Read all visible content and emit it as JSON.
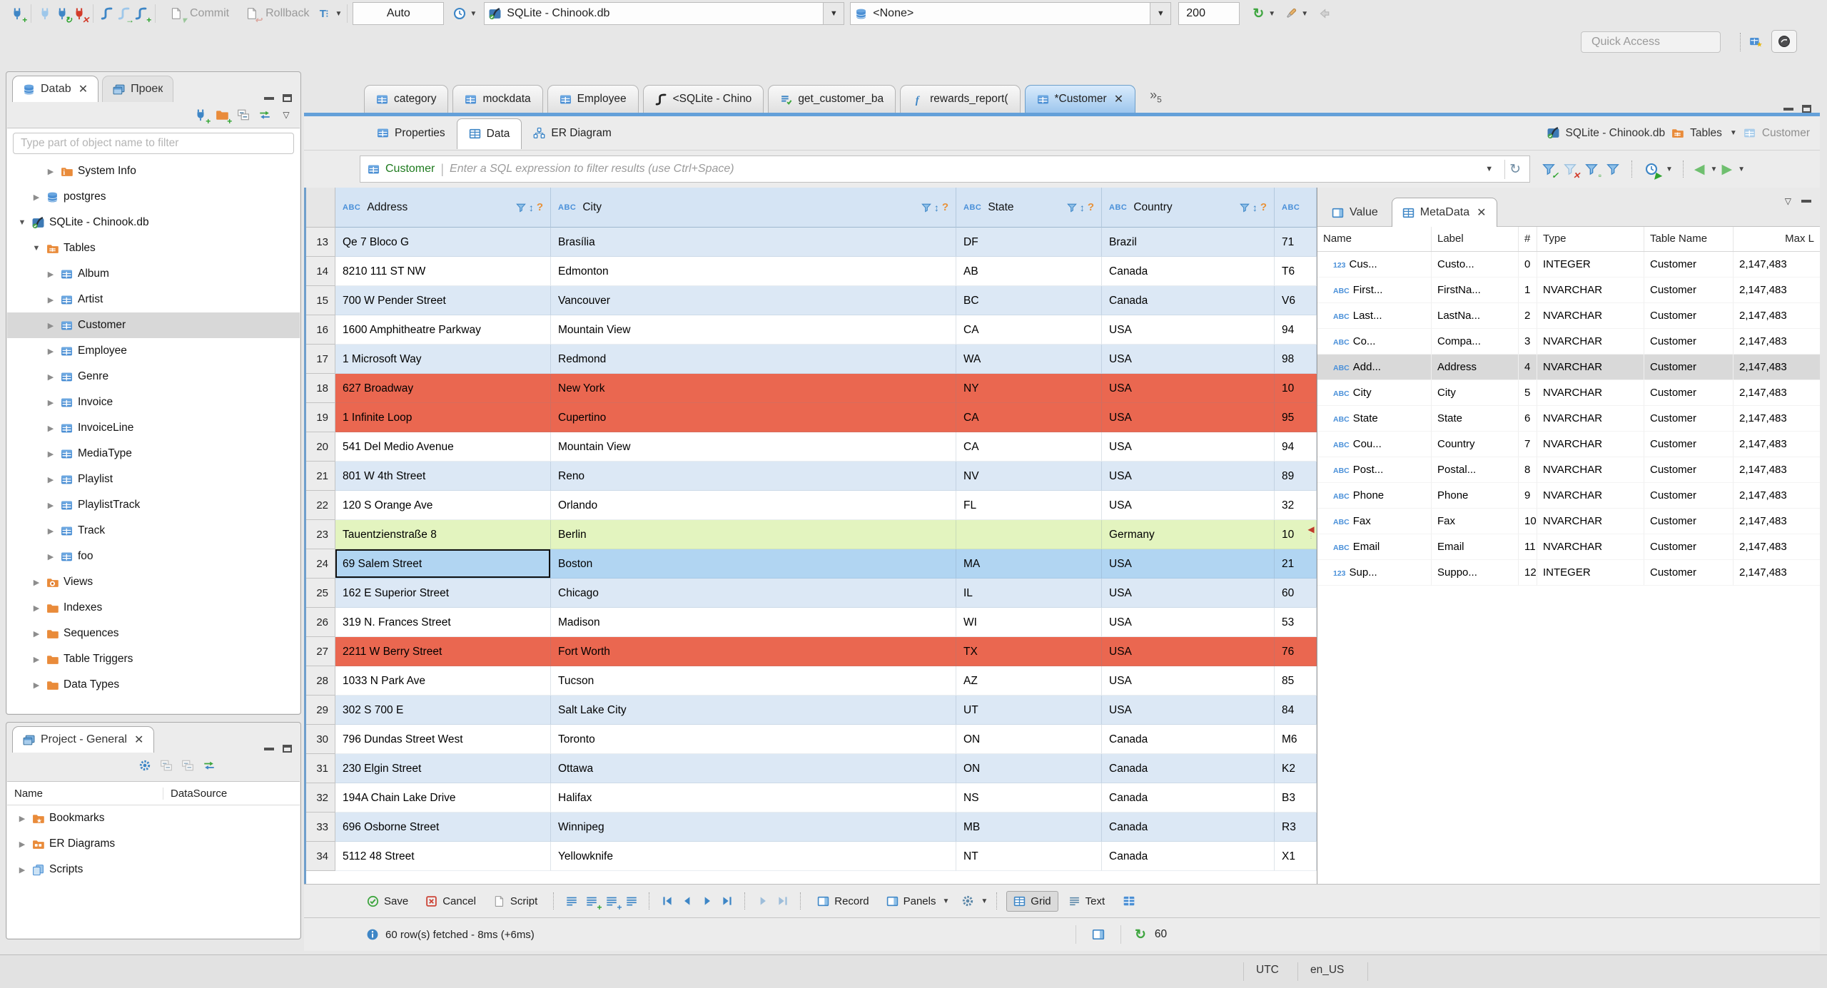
{
  "toolbar": {
    "commit_label": "Commit",
    "rollback_label": "Rollback",
    "auto_label": "Auto",
    "connection_value": "SQLite - Chinook.db",
    "database_value": "<None>",
    "fetch_size_value": "200",
    "quick_access_label": "Quick Access"
  },
  "navigator": {
    "tab_database": "Datab",
    "tab_project": "Проек",
    "filter_placeholder": "Type part of object name to filter",
    "tree": [
      {
        "label": "System Info",
        "icon": "#i-folder-info",
        "d": "d3",
        "arrow": "col",
        "sel": ""
      },
      {
        "label": "postgres",
        "icon": "#i-db",
        "d": "d2",
        "arrow": "col",
        "sel": ""
      },
      {
        "label": "SQLite - Chinook.db",
        "icon": "#i-sqlite",
        "d": "d1",
        "arrow": "exp",
        "sel": ""
      },
      {
        "label": "Tables",
        "icon": "#i-folder-tables",
        "d": "d2",
        "arrow": "exp",
        "sel": ""
      },
      {
        "label": "Album",
        "icon": "#i-table",
        "d": "d3",
        "arrow": "col",
        "sel": ""
      },
      {
        "label": "Artist",
        "icon": "#i-table",
        "d": "d3",
        "arrow": "col",
        "sel": ""
      },
      {
        "label": "Customer",
        "icon": "#i-table",
        "d": "d3",
        "arrow": "col",
        "sel": "sel"
      },
      {
        "label": "Employee",
        "icon": "#i-table",
        "d": "d3",
        "arrow": "col",
        "sel": ""
      },
      {
        "label": "Genre",
        "icon": "#i-table",
        "d": "d3",
        "arrow": "col",
        "sel": ""
      },
      {
        "label": "Invoice",
        "icon": "#i-table",
        "d": "d3",
        "arrow": "col",
        "sel": ""
      },
      {
        "label": "InvoiceLine",
        "icon": "#i-table",
        "d": "d3",
        "arrow": "col",
        "sel": ""
      },
      {
        "label": "MediaType",
        "icon": "#i-table",
        "d": "d3",
        "arrow": "col",
        "sel": ""
      },
      {
        "label": "Playlist",
        "icon": "#i-table",
        "d": "d3",
        "arrow": "col",
        "sel": ""
      },
      {
        "label": "PlaylistTrack",
        "icon": "#i-table",
        "d": "d3",
        "arrow": "col",
        "sel": ""
      },
      {
        "label": "Track",
        "icon": "#i-table",
        "d": "d3",
        "arrow": "col",
        "sel": ""
      },
      {
        "label": "foo",
        "icon": "#i-table",
        "d": "d3",
        "arrow": "col",
        "sel": ""
      },
      {
        "label": "Views",
        "icon": "#i-folder-views",
        "d": "d2",
        "arrow": "col",
        "sel": ""
      },
      {
        "label": "Indexes",
        "icon": "#i-folder",
        "d": "d2",
        "arrow": "col",
        "sel": ""
      },
      {
        "label": "Sequences",
        "icon": "#i-folder",
        "d": "d2",
        "arrow": "col",
        "sel": ""
      },
      {
        "label": "Table Triggers",
        "icon": "#i-folder",
        "d": "d2",
        "arrow": "col",
        "sel": ""
      },
      {
        "label": "Data Types",
        "icon": "#i-folder",
        "d": "d2",
        "arrow": "col",
        "sel": ""
      }
    ]
  },
  "project": {
    "title": "Project - General",
    "col_name": "Name",
    "col_datasource": "DataSource",
    "tree": [
      {
        "label": "Bookmarks",
        "icon": "#i-folder-star",
        "d": "d1",
        "arrow": "col",
        "sel": ""
      },
      {
        "label": "ER Diagrams",
        "icon": "#i-folder-er",
        "d": "d1",
        "arrow": "col",
        "sel": ""
      },
      {
        "label": "Scripts",
        "icon": "#i-scripts",
        "d": "d1",
        "arrow": "col",
        "sel": ""
      }
    ]
  },
  "editor": {
    "tabs": [
      {
        "label": "category",
        "icon": "#i-table",
        "state": "",
        "close": ""
      },
      {
        "label": "mockdata",
        "icon": "#i-table",
        "state": "",
        "close": ""
      },
      {
        "label": "Employee",
        "icon": "#i-table",
        "state": "",
        "close": ""
      },
      {
        "label": "<SQLite - Chino",
        "icon": "#i-sql",
        "state": "",
        "close": ""
      },
      {
        "label": "get_customer_ba",
        "icon": "#i-script-file",
        "state": "",
        "close": ""
      },
      {
        "label": "rewards_report(",
        "icon": "#i-fx",
        "state": "",
        "close": ""
      },
      {
        "label": "*Customer",
        "icon": "#i-table",
        "state": "active",
        "close": "show"
      }
    ],
    "overflow_count": "5",
    "subtab_properties": "Properties",
    "subtab_data": "Data",
    "subtab_er": "ER Diagram",
    "context_connection": "SQLite - Chinook.db",
    "context_container": "Tables",
    "context_object": "Customer"
  },
  "filter": {
    "table_label": "Customer",
    "placeholder": "Enter a SQL expression to filter results (use Ctrl+Space)"
  },
  "grid": {
    "columns": [
      "Address",
      "City",
      "State",
      "Country"
    ],
    "rows": [
      {
        "num": "13",
        "address": "Qe 7 Bloco G",
        "city": "Brasília",
        "state": "DF",
        "country": "Brazil",
        "postal": "71",
        "rc": "rb",
        "focus": ""
      },
      {
        "num": "14",
        "address": "8210 111 ST NW",
        "city": "Edmonton",
        "state": "AB",
        "country": "Canada",
        "postal": "T6",
        "rc": "rw",
        "focus": ""
      },
      {
        "num": "15",
        "address": "700 W Pender Street",
        "city": "Vancouver",
        "state": "BC",
        "country": "Canada",
        "postal": "V6",
        "rc": "rb",
        "focus": ""
      },
      {
        "num": "16",
        "address": "1600 Amphitheatre Parkway",
        "city": "Mountain View",
        "state": "CA",
        "country": "USA",
        "postal": "94",
        "rc": "rw",
        "focus": ""
      },
      {
        "num": "17",
        "address": "1 Microsoft Way",
        "city": "Redmond",
        "state": "WA",
        "country": "USA",
        "postal": "98",
        "rc": "rb",
        "focus": ""
      },
      {
        "num": "18",
        "address": "627 Broadway",
        "city": "New York",
        "state": "NY",
        "country": "USA",
        "postal": "10",
        "rc": "rr",
        "focus": ""
      },
      {
        "num": "19",
        "address": "1 Infinite Loop",
        "city": "Cupertino",
        "state": "CA",
        "country": "USA",
        "postal": "95",
        "rc": "rr",
        "focus": ""
      },
      {
        "num": "20",
        "address": "541 Del Medio Avenue",
        "city": "Mountain View",
        "state": "CA",
        "country": "USA",
        "postal": "94",
        "rc": "rw",
        "focus": ""
      },
      {
        "num": "21",
        "address": "801 W 4th Street",
        "city": "Reno",
        "state": "NV",
        "country": "USA",
        "postal": "89",
        "rc": "rb",
        "focus": ""
      },
      {
        "num": "22",
        "address": "120 S Orange Ave",
        "city": "Orlando",
        "state": "FL",
        "country": "USA",
        "postal": "32",
        "rc": "rw",
        "focus": ""
      },
      {
        "num": "23",
        "address": "Tauentzienstraße 8",
        "city": "Berlin",
        "state": "",
        "country": "Germany",
        "postal": "10",
        "rc": "rg",
        "focus": ""
      },
      {
        "num": "24",
        "address": "69 Salem Street",
        "city": "Boston",
        "state": "MA",
        "country": "USA",
        "postal": "21",
        "rc": "rs",
        "focus": "focus"
      },
      {
        "num": "25",
        "address": "162 E Superior Street",
        "city": "Chicago",
        "state": "IL",
        "country": "USA",
        "postal": "60",
        "rc": "rb",
        "focus": ""
      },
      {
        "num": "26",
        "address": "319 N. Frances Street",
        "city": "Madison",
        "state": "WI",
        "country": "USA",
        "postal": "53",
        "rc": "rw",
        "focus": ""
      },
      {
        "num": "27",
        "address": "2211 W Berry Street",
        "city": "Fort Worth",
        "state": "TX",
        "country": "USA",
        "postal": "76",
        "rc": "rr",
        "focus": ""
      },
      {
        "num": "28",
        "address": "1033 N Park Ave",
        "city": "Tucson",
        "state": "AZ",
        "country": "USA",
        "postal": "85",
        "rc": "rw",
        "focus": ""
      },
      {
        "num": "29",
        "address": "302 S 700 E",
        "city": "Salt Lake City",
        "state": "UT",
        "country": "USA",
        "postal": "84",
        "rc": "rb",
        "focus": ""
      },
      {
        "num": "30",
        "address": "796 Dundas Street West",
        "city": "Toronto",
        "state": "ON",
        "country": "Canada",
        "postal": "M6",
        "rc": "rw",
        "focus": ""
      },
      {
        "num": "31",
        "address": "230 Elgin Street",
        "city": "Ottawa",
        "state": "ON",
        "country": "Canada",
        "postal": "K2",
        "rc": "rb",
        "focus": ""
      },
      {
        "num": "32",
        "address": "194A Chain Lake Drive",
        "city": "Halifax",
        "state": "NS",
        "country": "Canada",
        "postal": "B3",
        "rc": "rw",
        "focus": ""
      },
      {
        "num": "33",
        "address": "696 Osborne Street",
        "city": "Winnipeg",
        "state": "MB",
        "country": "Canada",
        "postal": "R3",
        "rc": "rb",
        "focus": ""
      },
      {
        "num": "34",
        "address": "5112 48 Street",
        "city": "Yellowknife",
        "state": "NT",
        "country": "Canada",
        "postal": "X1",
        "rc": "rw",
        "focus": ""
      }
    ]
  },
  "meta": {
    "tab_value": "Value",
    "tab_metadata": "MetaData",
    "col_name": "Name",
    "col_label": "Label",
    "col_num": "#",
    "col_type": "Type",
    "col_table": "Table Name",
    "col_max": "Max L",
    "rows": [
      {
        "kind": "123",
        "name": "Cus...",
        "label": "Custo...",
        "num": "0",
        "type": "INTEGER",
        "table": "Customer",
        "max": "2,147,483",
        "rc": ""
      },
      {
        "kind": "ABC",
        "name": "First...",
        "label": "FirstNa...",
        "num": "1",
        "type": "NVARCHAR",
        "table": "Customer",
        "max": "2,147,483",
        "rc": ""
      },
      {
        "kind": "ABC",
        "name": "Last...",
        "label": "LastNa...",
        "num": "2",
        "type": "NVARCHAR",
        "table": "Customer",
        "max": "2,147,483",
        "rc": ""
      },
      {
        "kind": "ABC",
        "name": "Co...",
        "label": "Compa...",
        "num": "3",
        "type": "NVARCHAR",
        "table": "Customer",
        "max": "2,147,483",
        "rc": ""
      },
      {
        "kind": "ABC",
        "name": "Add...",
        "label": "Address",
        "num": "4",
        "type": "NVARCHAR",
        "table": "Customer",
        "max": "2,147,483",
        "rc": "sel"
      },
      {
        "kind": "ABC",
        "name": "City",
        "label": "City",
        "num": "5",
        "type": "NVARCHAR",
        "table": "Customer",
        "max": "2,147,483",
        "rc": ""
      },
      {
        "kind": "ABC",
        "name": "State",
        "label": "State",
        "num": "6",
        "type": "NVARCHAR",
        "table": "Customer",
        "max": "2,147,483",
        "rc": ""
      },
      {
        "kind": "ABC",
        "name": "Cou...",
        "label": "Country",
        "num": "7",
        "type": "NVARCHAR",
        "table": "Customer",
        "max": "2,147,483",
        "rc": ""
      },
      {
        "kind": "ABC",
        "name": "Post...",
        "label": "Postal...",
        "num": "8",
        "type": "NVARCHAR",
        "table": "Customer",
        "max": "2,147,483",
        "rc": ""
      },
      {
        "kind": "ABC",
        "name": "Phone",
        "label": "Phone",
        "num": "9",
        "type": "NVARCHAR",
        "table": "Customer",
        "max": "2,147,483",
        "rc": ""
      },
      {
        "kind": "ABC",
        "name": "Fax",
        "label": "Fax",
        "num": "10",
        "type": "NVARCHAR",
        "table": "Customer",
        "max": "2,147,483",
        "rc": ""
      },
      {
        "kind": "ABC",
        "name": "Email",
        "label": "Email",
        "num": "11",
        "type": "NVARCHAR",
        "table": "Customer",
        "max": "2,147,483",
        "rc": ""
      },
      {
        "kind": "123",
        "name": "Sup...",
        "label": "Suppo...",
        "num": "12",
        "type": "INTEGER",
        "table": "Customer",
        "max": "2,147,483",
        "rc": ""
      }
    ]
  },
  "result_toolbar": {
    "save": "Save",
    "cancel": "Cancel",
    "script": "Script",
    "record": "Record",
    "panels": "Panels",
    "grid": "Grid",
    "text": "Text"
  },
  "status": {
    "fetched": "60 row(s) fetched - 8ms (+6ms)",
    "refresh_count": "60"
  },
  "statusbar": {
    "timezone": "UTC",
    "locale": "en_US"
  }
}
